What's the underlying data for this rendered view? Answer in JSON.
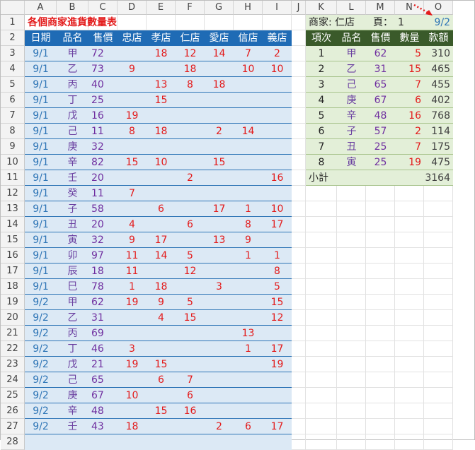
{
  "columns": [
    "A",
    "B",
    "C",
    "D",
    "E",
    "F",
    "G",
    "H",
    "I",
    "J",
    "K",
    "L",
    "M",
    "N",
    "O"
  ],
  "left": {
    "title": "各個商家進貨數量表",
    "headers": [
      "日期",
      "品名",
      "售價",
      "忠店",
      "孝店",
      "仁店",
      "愛店",
      "信店",
      "義店"
    ],
    "rows": [
      [
        "9/1",
        "甲",
        "72",
        "",
        "18",
        "12",
        "14",
        "7",
        "2"
      ],
      [
        "9/1",
        "乙",
        "73",
        "9",
        "",
        "18",
        "",
        "10",
        "10"
      ],
      [
        "9/1",
        "丙",
        "40",
        "",
        "13",
        "8",
        "18",
        "",
        ""
      ],
      [
        "9/1",
        "丁",
        "25",
        "",
        "15",
        "",
        "",
        "",
        ""
      ],
      [
        "9/1",
        "戊",
        "16",
        "19",
        "",
        "",
        "",
        "",
        ""
      ],
      [
        "9/1",
        "己",
        "11",
        "8",
        "18",
        "",
        "2",
        "14",
        ""
      ],
      [
        "9/1",
        "庚",
        "32",
        "",
        "",
        "",
        "",
        "",
        ""
      ],
      [
        "9/1",
        "辛",
        "82",
        "15",
        "10",
        "",
        "15",
        "",
        ""
      ],
      [
        "9/1",
        "壬",
        "20",
        "",
        "",
        "2",
        "",
        "",
        "16"
      ],
      [
        "9/1",
        "癸",
        "11",
        "7",
        "",
        "",
        "",
        "",
        ""
      ],
      [
        "9/1",
        "子",
        "58",
        "",
        "6",
        "",
        "17",
        "1",
        "10"
      ],
      [
        "9/1",
        "丑",
        "20",
        "4",
        "",
        "6",
        "",
        "8",
        "17"
      ],
      [
        "9/1",
        "寅",
        "32",
        "9",
        "17",
        "",
        "13",
        "9",
        ""
      ],
      [
        "9/1",
        "卯",
        "97",
        "11",
        "14",
        "5",
        "",
        "1",
        "1"
      ],
      [
        "9/1",
        "辰",
        "18",
        "11",
        "",
        "12",
        "",
        "",
        "8"
      ],
      [
        "9/1",
        "巳",
        "78",
        "1",
        "18",
        "",
        "3",
        "",
        "5"
      ],
      [
        "9/2",
        "甲",
        "62",
        "19",
        "9",
        "5",
        "",
        "",
        "15"
      ],
      [
        "9/2",
        "乙",
        "31",
        "",
        "4",
        "15",
        "",
        "",
        "12"
      ],
      [
        "9/2",
        "丙",
        "69",
        "",
        "",
        "",
        "",
        "13",
        ""
      ],
      [
        "9/2",
        "丁",
        "46",
        "3",
        "",
        "",
        "",
        "1",
        "17"
      ],
      [
        "9/2",
        "戊",
        "21",
        "19",
        "15",
        "",
        "",
        "",
        "19"
      ],
      [
        "9/2",
        "己",
        "65",
        "",
        "6",
        "7",
        "",
        "",
        ""
      ],
      [
        "9/2",
        "庚",
        "67",
        "10",
        "",
        "6",
        "",
        "",
        ""
      ],
      [
        "9/2",
        "辛",
        "48",
        "",
        "15",
        "16",
        "",
        "",
        ""
      ],
      [
        "9/2",
        "壬",
        "43",
        "18",
        "",
        "",
        "2",
        "6",
        "17"
      ]
    ]
  },
  "right": {
    "merchant_label": "商家: 仁店",
    "page_label": "頁：",
    "page_value": "1",
    "date": "9/2",
    "headers": [
      "項次",
      "品名",
      "售價",
      "數量",
      "款額"
    ],
    "rows": [
      [
        "1",
        "甲",
        "62",
        "5",
        "310"
      ],
      [
        "2",
        "乙",
        "31",
        "15",
        "465"
      ],
      [
        "3",
        "己",
        "65",
        "7",
        "455"
      ],
      [
        "4",
        "庚",
        "67",
        "6",
        "402"
      ],
      [
        "5",
        "辛",
        "48",
        "16",
        "768"
      ],
      [
        "6",
        "子",
        "57",
        "2",
        "114"
      ],
      [
        "7",
        "丑",
        "25",
        "7",
        "175"
      ],
      [
        "8",
        "寅",
        "25",
        "19",
        "475"
      ]
    ],
    "subtotal_label": "小計",
    "subtotal_value": "3164"
  },
  "colors": {
    "left_header": "#1f6bb5",
    "left_fill": "#dce9f5",
    "right_header": "#3a5a2a",
    "right_fill": "#e3efd8",
    "qty_red": "#e31b1b",
    "date_blue": "#2e75b6",
    "price_purple": "#7030a0",
    "arrow_red": "#e31b1b"
  }
}
